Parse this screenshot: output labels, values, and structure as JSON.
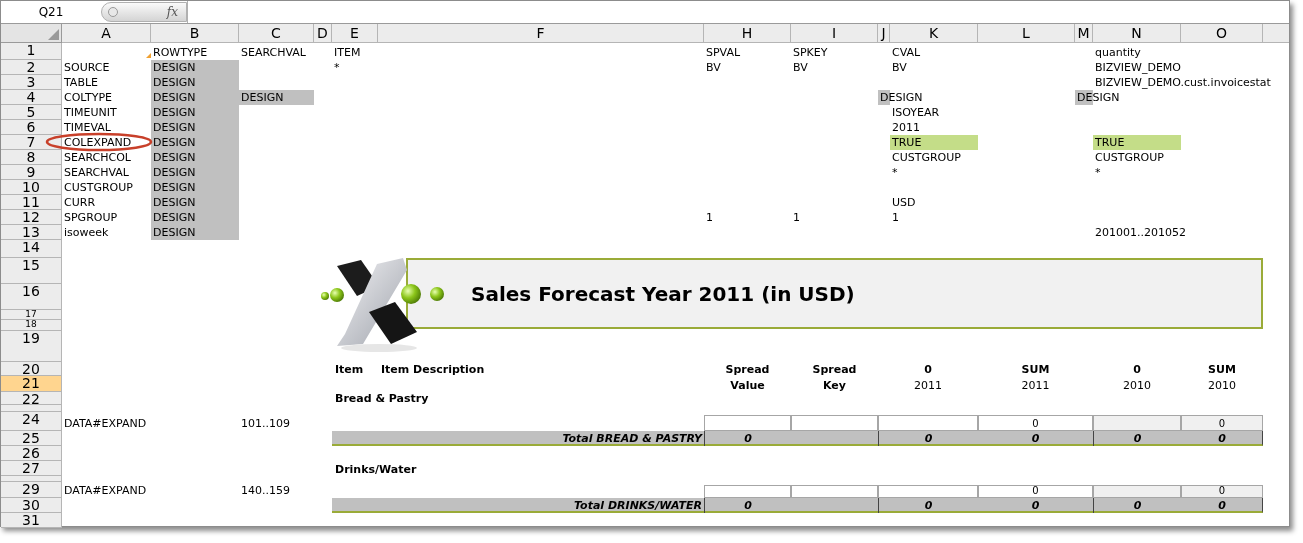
{
  "formula_bar": {
    "name_box": "Q21",
    "fx": "fx"
  },
  "columns": [
    "A",
    "B",
    "C",
    "D",
    "E",
    "F",
    "H",
    "I",
    "J",
    "K",
    "L",
    "M",
    "N",
    "O"
  ],
  "banner": {
    "title": "Sales Forecast Year 2011 (in USD)"
  },
  "rows": [
    {
      "label": "1",
      "selected": false,
      "cells": [
        null,
        "ROWTYPE",
        "SEARCHVAL",
        null,
        "ITEM",
        null,
        "SPVAL",
        "SPKEY",
        null,
        "CVAL",
        null,
        null,
        "quantity",
        null
      ]
    },
    {
      "label": "2",
      "selected": false,
      "cells": [
        "SOURCE",
        {
          "text": "DESIGN",
          "color": "#c0c0c0"
        },
        null,
        null,
        "*",
        null,
        "BV",
        "BV",
        null,
        "BV",
        null,
        null,
        "BIZVIEW_DEMO",
        null
      ]
    },
    {
      "label": "3",
      "selected": false,
      "cells": [
        "TABLE",
        {
          "text": "DESIGN",
          "color": "#c0c0c0"
        },
        null,
        null,
        null,
        null,
        null,
        null,
        null,
        null,
        null,
        null,
        "BIZVIEW_DEMO.cust.invoicestat",
        null
      ]
    },
    {
      "label": "4",
      "selected": false,
      "cells": [
        "COLTYPE",
        {
          "text": "DESIGN",
          "color": "#c0c0c0"
        },
        {
          "text": "DESIGN",
          "color": "#c0c0c0"
        },
        null,
        null,
        null,
        null,
        null,
        {
          "text": "DESIGN",
          "color": "#c0c0c0"
        },
        null,
        null,
        {
          "text": "DESIGN",
          "color": "#c0c0c0"
        },
        null,
        null
      ]
    },
    {
      "label": "5",
      "selected": false,
      "cells": [
        "TIMEUNIT",
        {
          "text": "DESIGN",
          "color": "#c0c0c0"
        },
        null,
        null,
        null,
        null,
        null,
        null,
        null,
        "ISOYEAR",
        null,
        null,
        null,
        null
      ]
    },
    {
      "label": "6",
      "selected": false,
      "cells": [
        "TIMEVAL",
        {
          "text": "DESIGN",
          "color": "#c0c0c0"
        },
        null,
        null,
        null,
        null,
        null,
        null,
        null,
        "2011",
        null,
        null,
        null,
        null
      ]
    },
    {
      "label": "7",
      "selected": false,
      "cells": [
        "COLEXPAND",
        {
          "text": "DESIGN",
          "color": "#c0c0c0"
        },
        null,
        null,
        null,
        null,
        null,
        null,
        null,
        {
          "text": "TRUE",
          "color": "#c4dd88"
        },
        null,
        null,
        {
          "text": "TRUE",
          "color": "#c4dd88"
        },
        null
      ]
    },
    {
      "label": "8",
      "selected": false,
      "cells": [
        "SEARCHCOL",
        {
          "text": "DESIGN",
          "color": "#c0c0c0"
        },
        null,
        null,
        null,
        null,
        null,
        null,
        null,
        "CUSTGROUP",
        null,
        null,
        "CUSTGROUP",
        null
      ]
    },
    {
      "label": "9",
      "selected": false,
      "cells": [
        "SEARCHVAL",
        {
          "text": "DESIGN",
          "color": "#c0c0c0"
        },
        null,
        null,
        null,
        null,
        null,
        null,
        null,
        "*",
        null,
        null,
        "*",
        null
      ]
    },
    {
      "label": "10",
      "selected": false,
      "cells": [
        "CUSTGROUP",
        {
          "text": "DESIGN",
          "color": "#c0c0c0"
        },
        null,
        null,
        null,
        null,
        null,
        null,
        null,
        null,
        null,
        null,
        null,
        null
      ]
    },
    {
      "label": "11",
      "selected": false,
      "cells": [
        "CURR",
        {
          "text": "DESIGN",
          "color": "#c0c0c0"
        },
        null,
        null,
        null,
        null,
        null,
        null,
        null,
        "USD",
        null,
        null,
        null,
        null
      ]
    },
    {
      "label": "12",
      "selected": false,
      "cells": [
        "SPGROUP",
        {
          "text": "DESIGN",
          "color": "#c0c0c0"
        },
        null,
        null,
        null,
        null,
        "1",
        "1",
        null,
        "1",
        null,
        null,
        null,
        null
      ]
    },
    {
      "label": "13",
      "selected": false,
      "cells": [
        "isoweek",
        {
          "text": "DESIGN",
          "color": "#c0c0c0"
        },
        null,
        null,
        null,
        null,
        null,
        null,
        null,
        null,
        null,
        null,
        "201001..201052",
        null
      ]
    },
    {
      "label": "14",
      "selected": false
    },
    {
      "label": "15",
      "selected": false
    },
    {
      "label": "16",
      "selected": false
    },
    {
      "label": "17",
      "selected": false
    },
    {
      "label": "18",
      "selected": false
    },
    {
      "label": "19",
      "selected": false
    },
    {
      "label": "20",
      "selected": false,
      "cells": [
        null,
        null,
        null,
        null,
        {
          "text": "Item",
          "kind": "label"
        },
        {
          "text": "Item Description",
          "kind": "label"
        },
        {
          "text": "Spread",
          "kind": "head"
        },
        {
          "text": "Spread",
          "kind": "head"
        },
        null,
        {
          "text": "0",
          "kind": "head"
        },
        {
          "text": "SUM",
          "kind": "head"
        },
        null,
        {
          "text": "0",
          "kind": "head"
        },
        {
          "text": "SUM",
          "kind": "head"
        }
      ]
    },
    {
      "label": "21",
      "selected": true,
      "cells": [
        null,
        null,
        null,
        null,
        null,
        null,
        {
          "text": "Value",
          "kind": "head"
        },
        {
          "text": "Key",
          "kind": "head"
        },
        null,
        {
          "text": "2011",
          "kind": "sub"
        },
        {
          "text": "2011",
          "kind": "sub"
        },
        null,
        {
          "text": "2010",
          "kind": "sub"
        },
        {
          "text": "2010",
          "kind": "sub"
        }
      ]
    },
    {
      "label": "22",
      "selected": false,
      "cells": [
        null,
        null,
        null,
        null,
        {
          "text": "Bread & Pastry",
          "kind": "label"
        },
        null,
        null,
        null,
        null,
        null,
        null,
        null,
        null,
        null
      ]
    },
    {
      "selected": false
    },
    {
      "label": "24",
      "selected": false,
      "cells": [
        "DATA#EXPAND",
        null,
        "101..109",
        null,
        null,
        null,
        {
          "kind": "input",
          "shaded": false
        },
        {
          "kind": "input",
          "shaded": false
        },
        null,
        {
          "kind": "input",
          "shaded": false
        },
        {
          "kind": "input",
          "text": "0",
          "shaded": false
        },
        null,
        {
          "kind": "input",
          "shaded": true
        },
        {
          "kind": "input",
          "text": "0",
          "shaded": true
        }
      ]
    },
    {
      "label": "25",
      "selected": false,
      "kind": "total",
      "cells": [
        null,
        null,
        null,
        null,
        {
          "text": "Total BREAD & PASTRY",
          "kind": "total_label"
        },
        null,
        {
          "text": "0",
          "kind": "total"
        },
        null,
        null,
        {
          "text": "0",
          "kind": "total"
        },
        {
          "text": "0",
          "kind": "total"
        },
        null,
        {
          "text": "0",
          "kind": "total"
        },
        {
          "text": "0",
          "kind": "total"
        }
      ]
    },
    {
      "label": "26",
      "selected": false
    },
    {
      "label": "27",
      "selected": false,
      "cells": [
        null,
        null,
        null,
        null,
        {
          "text": "Drinks/Water",
          "kind": "label"
        },
        null,
        null,
        null,
        null,
        null,
        null,
        null,
        null,
        null
      ]
    },
    {
      "selected": false
    },
    {
      "label": "29",
      "selected": false,
      "cells": [
        "DATA#EXPAND",
        null,
        "140..159",
        null,
        null,
        null,
        {
          "kind": "input",
          "shaded": false
        },
        {
          "kind": "input",
          "shaded": false
        },
        null,
        {
          "kind": "input",
          "shaded": false
        },
        {
          "kind": "input",
          "text": "0",
          "shaded": false
        },
        null,
        {
          "kind": "input",
          "shaded": true
        },
        {
          "kind": "input",
          "text": "0",
          "shaded": true
        }
      ]
    },
    {
      "label": "30",
      "selected": false,
      "kind": "total",
      "cells": [
        null,
        null,
        null,
        null,
        {
          "text": "Total DRINKS/WATER",
          "kind": "total_label"
        },
        null,
        {
          "text": "0",
          "kind": "total"
        },
        null,
        null,
        {
          "text": "0",
          "kind": "total"
        },
        {
          "text": "0",
          "kind": "total"
        },
        null,
        {
          "text": "0",
          "kind": "total"
        },
        {
          "text": "0",
          "kind": "total"
        }
      ]
    },
    {
      "label": "31",
      "selected": false
    }
  ]
}
